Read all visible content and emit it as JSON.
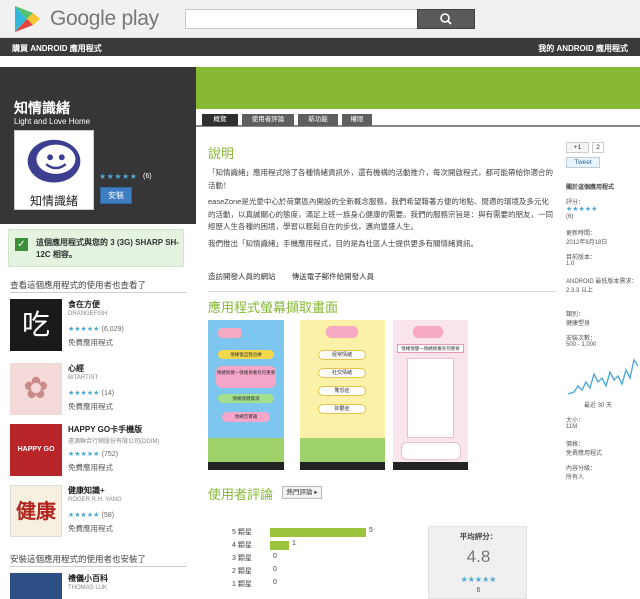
{
  "header": {
    "store_name": "Google play",
    "search_placeholder": "",
    "nav_left": "購買 ANDROID 應用程式",
    "nav_right": "我的 ANDROID 應用程式"
  },
  "app": {
    "title": "知情識緒",
    "developer": "Light and Love Home",
    "icon_text": "知情識緒",
    "stars": "★★★★★",
    "rating_count": "(6)",
    "install_label": "安裝",
    "compat_text": "這個應用程式與您的 3 (3G) SHARP SH-12C 相容。"
  },
  "sidebar": {
    "also_viewed_heading": "查看這個應用程式的使用者也查看了",
    "also_installed_heading": "安裝這個應用程式的使用者也安裝了",
    "related": [
      {
        "title": "食在方便",
        "dev": "DRANGEFISH",
        "stars": "★★★★★",
        "count": "(6,029)",
        "price": "免費應用程式",
        "icon_char": "吃"
      },
      {
        "title": "心經",
        "dev": "BITARTIST",
        "stars": "★★★★★",
        "count": "(14)",
        "price": "免費應用程式",
        "icon_char": "✿"
      },
      {
        "title": "HAPPY GO卡手機版",
        "dev": "遠源聯合行銷股份有限公司(DDIM)",
        "stars": "★★★★★",
        "count": "(752)",
        "price": "免費應用程式",
        "icon_char": "HAPPY GO"
      },
      {
        "title": "健康知識+",
        "dev": "ROGER R.H. YANG",
        "stars": "★★★★★",
        "count": "(58)",
        "price": "免費應用程式",
        "icon_char": "健康"
      }
    ],
    "installed": [
      {
        "title": "禮儀小百科",
        "dev": "THOMAS LUK"
      }
    ]
  },
  "tabs": [
    "概覽",
    "使用者評論",
    "新功能",
    "權限"
  ],
  "description": {
    "heading": "說明",
    "p1": "「知情識緒」應用程式除了各種情緒資訊外，還有機構的活動推介，每次開啟程式，都可能帶給你適合的活動！",
    "p2": "easeZone是光愛中心於荷葉區內開設的全新概念服務，我們希望藉著方便的地點、閒適的環境及多元化的活動，以真誠關心的態度，滿足上班一族身心健康的需要。我們的服務宗旨是：與有需要的朋友，一同經歷人生各種的困境，學習以輕鬆自在的步伐，邁向豐盛人生。",
    "p3": "我們推出「知情識緒」手機應用程式，目的是為社區人士提供更多有關情緒資訊。",
    "link_site": "造訪開發人員的網站",
    "link_email": "傳送電子郵件給開發人員"
  },
  "screenshots": {
    "heading": "應用程式螢幕擷取畫面",
    "items": [
      {
        "buttons": [
          "情緒復自我治療",
          "情緒保健一情緒保養有何重要",
          "情緒保健資源",
          "情緒百寶箱"
        ]
      },
      {
        "buttons": [
          "經常情緒",
          "社交情緒",
          "驚恐症",
          "抑鬱症"
        ]
      },
      {
        "buttons": [
          "情緒保健一情緒保養有何重要"
        ]
      }
    ]
  },
  "reviews": {
    "heading": "使用者評論",
    "sort_label": "熱門評論 ▸",
    "rows": [
      {
        "label": "5 顆星",
        "count": "5",
        "value": 5
      },
      {
        "label": "4 顆星",
        "count": "1",
        "value": 1
      },
      {
        "label": "3 顆星",
        "count": "0",
        "value": 0
      },
      {
        "label": "2 顆星",
        "count": "0",
        "value": 0
      },
      {
        "label": "1 顆星",
        "count": "0",
        "value": 0
      }
    ],
    "avg_label": "平均評分：",
    "avg_value": "4.8",
    "avg_stars": "★★★★★",
    "avg_count": "6"
  },
  "side": {
    "gplus": "+1",
    "gplus_count": "2",
    "tweet": "Tweet",
    "detail_heading": "關於這個應用程式",
    "rating_label": "評分：",
    "rating_stars": "★★★★★",
    "rating_count": "(6)",
    "updated_label": "更新時間：",
    "updated_value": "2012年8月18日",
    "version_label": "目前版本：",
    "version_value": "1.0",
    "android_label": "ANDROID 最低版本需求：",
    "android_value": "2.3.3 以上",
    "category_label": "類別：",
    "category_value": "健康塑身",
    "installs_label": "安裝次數：",
    "installs_value": "500 - 1,000",
    "chart_caption": "最近 30 天",
    "size_label": "大小：",
    "size_value": "11M",
    "price_label": "價格：",
    "price_value": "免費應用程式",
    "rating2_label": "內容分級：",
    "rating2_value": "所有人"
  },
  "colors": {
    "accent_green": "#86b834",
    "star_blue": "#4fa8d6",
    "dark": "#363636"
  }
}
